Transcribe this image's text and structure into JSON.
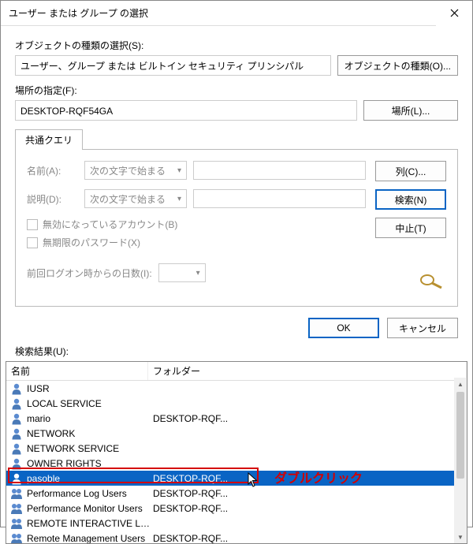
{
  "window": {
    "title": "ユーザー または グループ の選択"
  },
  "objectTypes": {
    "label": "オブジェクトの種類の選択(S):",
    "value": "ユーザー、グループ または ビルトイン セキュリティ プリンシパル",
    "button": "オブジェクトの種類(O)..."
  },
  "location": {
    "label": "場所の指定(F):",
    "value": "DESKTOP-RQF54GA",
    "button": "場所(L)..."
  },
  "tab": {
    "label": "共通クエリ"
  },
  "query": {
    "nameLabel": "名前(A):",
    "nameMode": "次の文字で始まる",
    "descLabel": "説明(D):",
    "descMode": "次の文字で始まる",
    "disabledAccounts": "無効になっているアカウント(B)",
    "nonExpiringPw": "無期限のパスワード(X)",
    "lastLogonLabel": "前回ログオン時からの日数(I):"
  },
  "sideButtons": {
    "columns": "列(C)...",
    "search": "検索(N)",
    "stop": "中止(T)"
  },
  "dlg": {
    "ok": "OK",
    "cancel": "キャンセル"
  },
  "results": {
    "label": "検索結果(U):",
    "colName": "名前",
    "colFolder": "フォルダー",
    "rows": [
      {
        "icon": "user",
        "name": "IUSR",
        "folder": ""
      },
      {
        "icon": "user",
        "name": "LOCAL SERVICE",
        "folder": ""
      },
      {
        "icon": "user",
        "name": "mario",
        "folder": "DESKTOP-RQF..."
      },
      {
        "icon": "user",
        "name": "NETWORK",
        "folder": ""
      },
      {
        "icon": "user",
        "name": "NETWORK SERVICE",
        "folder": ""
      },
      {
        "icon": "user",
        "name": "OWNER RIGHTS",
        "folder": ""
      },
      {
        "icon": "user",
        "name": "pasoble",
        "folder": "DESKTOP-RQF...",
        "selected": true
      },
      {
        "icon": "group",
        "name": "Performance Log Users",
        "folder": "DESKTOP-RQF..."
      },
      {
        "icon": "group",
        "name": "Performance Monitor Users",
        "folder": "DESKTOP-RQF..."
      },
      {
        "icon": "group",
        "name": "REMOTE INTERACTIVE LOG...",
        "folder": ""
      },
      {
        "icon": "group",
        "name": "Remote Management Users",
        "folder": "DESKTOP-RQF..."
      }
    ]
  },
  "annotation": {
    "text": "ダブルクリック"
  }
}
